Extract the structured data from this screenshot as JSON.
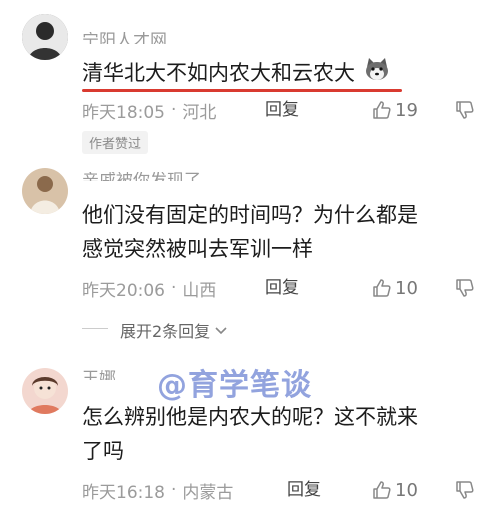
{
  "colors": {
    "underline": "#d93a30",
    "watermark": "#7f93d9"
  },
  "comments": [
    {
      "username": "宁阳人才网",
      "content": "清华北大不如内农大和云农大",
      "emoji": "husky-emoji",
      "time": "昨天18:05",
      "location": "河北",
      "reply_label": "回复",
      "likes": "19",
      "badge": "作者赞过"
    },
    {
      "username": "亲戚被你发现了",
      "content_line1": "他们没有固定的时间吗？为什么都是",
      "content_line2": "感觉突然被叫去军训一样",
      "time": "昨天20:06",
      "location": "山西",
      "reply_label": "回复",
      "likes": "10",
      "expand_label": "展开2条回复"
    },
    {
      "username": "王娜",
      "content_line1": "怎么辨别他是内农大的呢？这不就来",
      "content_line2": "了吗",
      "time": "昨天16:18",
      "location": "内蒙古",
      "reply_label": "回复",
      "likes": "10"
    }
  ],
  "watermark": "@育学笔谈"
}
